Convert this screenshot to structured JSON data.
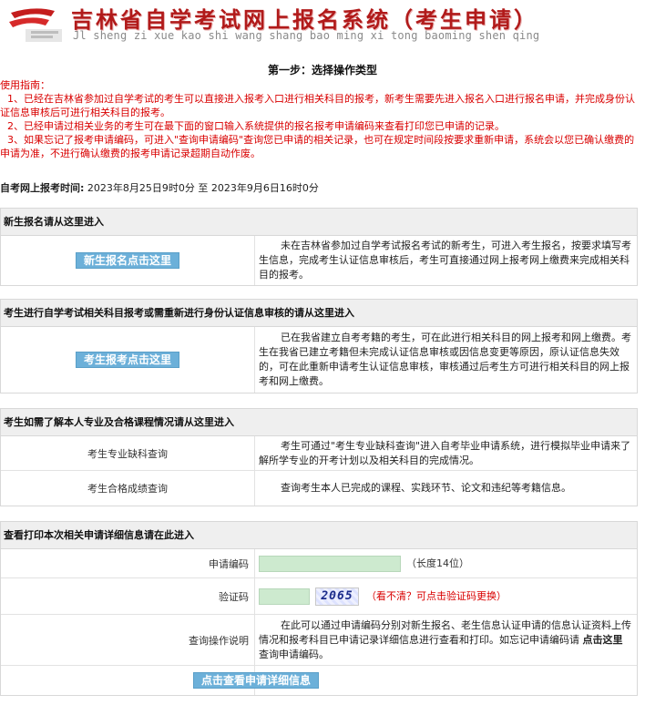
{
  "header": {
    "title": "吉林省自学考试网上报名系统（考生申请）",
    "pinyin": "Jl sheng zi xue kao shi wang shang bao ming xi tong baoming shen qing"
  },
  "step_title": "第一步：选择操作类型",
  "guide": {
    "heading": "使用指南：",
    "items": [
      "1、已经在吉林省参加过自学考试的考生可以直接进入报考入口进行相关科目的报考，新考生需要先进入报名入口进行报名申请，并完成身份认证信息审核后可进行相关科目的报考。",
      "2、已经申请过相关业务的考生可在最下面的窗口输入系统提供的报名报考申请编码来查看打印您已申请的记录。",
      "3、如果忘记了报考申请编码，可进入\"查询申请编码\"查询您已申请的相关记录，也可在规定时间段按要求重新申请，系统会以您已确认缴费的申请为准，不进行确认缴费的报考申请记录超期自动作废。"
    ]
  },
  "time": {
    "label": "自考网上报考时间:",
    "value": "2023年8月25日9时0分 至 2023年9月6日16时0分"
  },
  "section_new": {
    "head": "新生报名请从这里进入",
    "button": "新生报名点击这里",
    "desc": "未在吉林省参加过自学考试报名考试的新考生，可进入考生报名，按要求填写考生信息，完成考生认证信息审核后，考生可直接通过网上报考网上缴费来完成相关科目的报考。"
  },
  "section_exam": {
    "head": "考生进行自学考试相关科目报考或需重新进行身份认证信息审核的请从这里进入",
    "button": "考生报考点击这里",
    "desc": "已在我省建立自考考籍的考生，可在此进行相关科目的网上报考和网上缴费。考生在我省已建立考籍但未完成认证信息审核或因信息变更等原因，原认证信息失效的，可在此重新申请考生认证信息审核，审核通过后考生方可进行相关科目的网上报考和网上缴费。"
  },
  "section_query": {
    "head": "考生如需了解本人专业及合格课程情况请从这里进入",
    "rows": [
      {
        "label": "考生专业缺科查询",
        "desc": "考生可通过\"考生专业缺科查询\"进入自考毕业申请系统，进行模拟毕业申请来了解所学专业的开考计划以及相关科目的完成情况。"
      },
      {
        "label": "考生合格成绩查询",
        "desc": "查询考生本人已完成的课程、实践环节、论文和违纪等考籍信息。"
      }
    ]
  },
  "section_print": {
    "head": "查看打印本次相关申请详细信息请在此进入",
    "code_label": "申请编码",
    "code_value": "",
    "code_hint": "（长度14位）",
    "captcha_label": "验证码",
    "captcha_value": "",
    "captcha_text": "2065",
    "captcha_hint": "（看不清？可点击验证码更换）",
    "info_label": "查询操作说明",
    "info_text_1": "在此可以通过申请编码分别对新生报名、老生信息认证申请的信息认证资料上传情况和报考科目已申请记录详细信息进行查看和打印。如忘记申请编码请",
    "info_link": "点击这里",
    "info_text_2": "查询申请编码。",
    "submit_button": "点击查看申请详细信息"
  },
  "colors": {
    "title_red": "#b11a1a",
    "guide_red": "#d90000",
    "button_blue": "#6cb0d9",
    "input_green": "#cdeacf"
  }
}
